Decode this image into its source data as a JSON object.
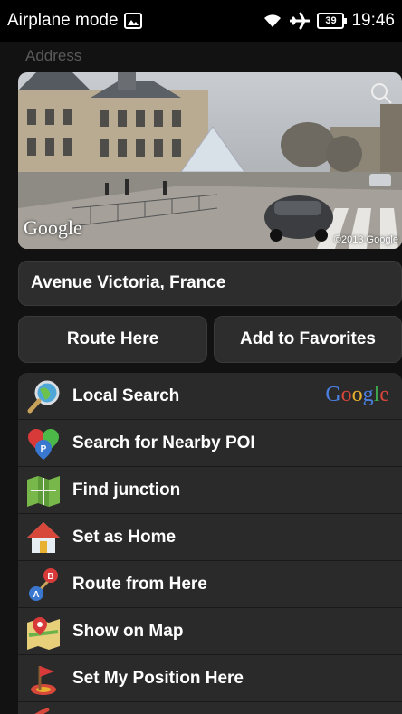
{
  "status_bar": {
    "mode_label": "Airplane mode",
    "battery": "39",
    "time": "19:46"
  },
  "section_label": "Address",
  "street_view": {
    "brand": "Google",
    "copyright": "©2013 Google"
  },
  "address": "Avenue Victoria, France",
  "buttons": {
    "route_here": "Route Here",
    "add_favorites": "Add to Favorites"
  },
  "menu": {
    "items": [
      {
        "label": "Local Search",
        "icon": "magnifier-globe-icon"
      },
      {
        "label": "Search for Nearby POI",
        "icon": "poi-pins-icon"
      },
      {
        "label": "Find junction",
        "icon": "folded-map-icon"
      },
      {
        "label": "Set as Home",
        "icon": "home-icon"
      },
      {
        "label": "Route from Here",
        "icon": "route-ab-icon"
      },
      {
        "label": "Show on Map",
        "icon": "map-pin-icon"
      },
      {
        "label": "Set My Position Here",
        "icon": "position-flag-icon"
      }
    ],
    "google_brand": "Google"
  },
  "colors": {
    "background": "#121212",
    "panel": "#2d2d2d",
    "muted_label": "#5a5a5a"
  }
}
